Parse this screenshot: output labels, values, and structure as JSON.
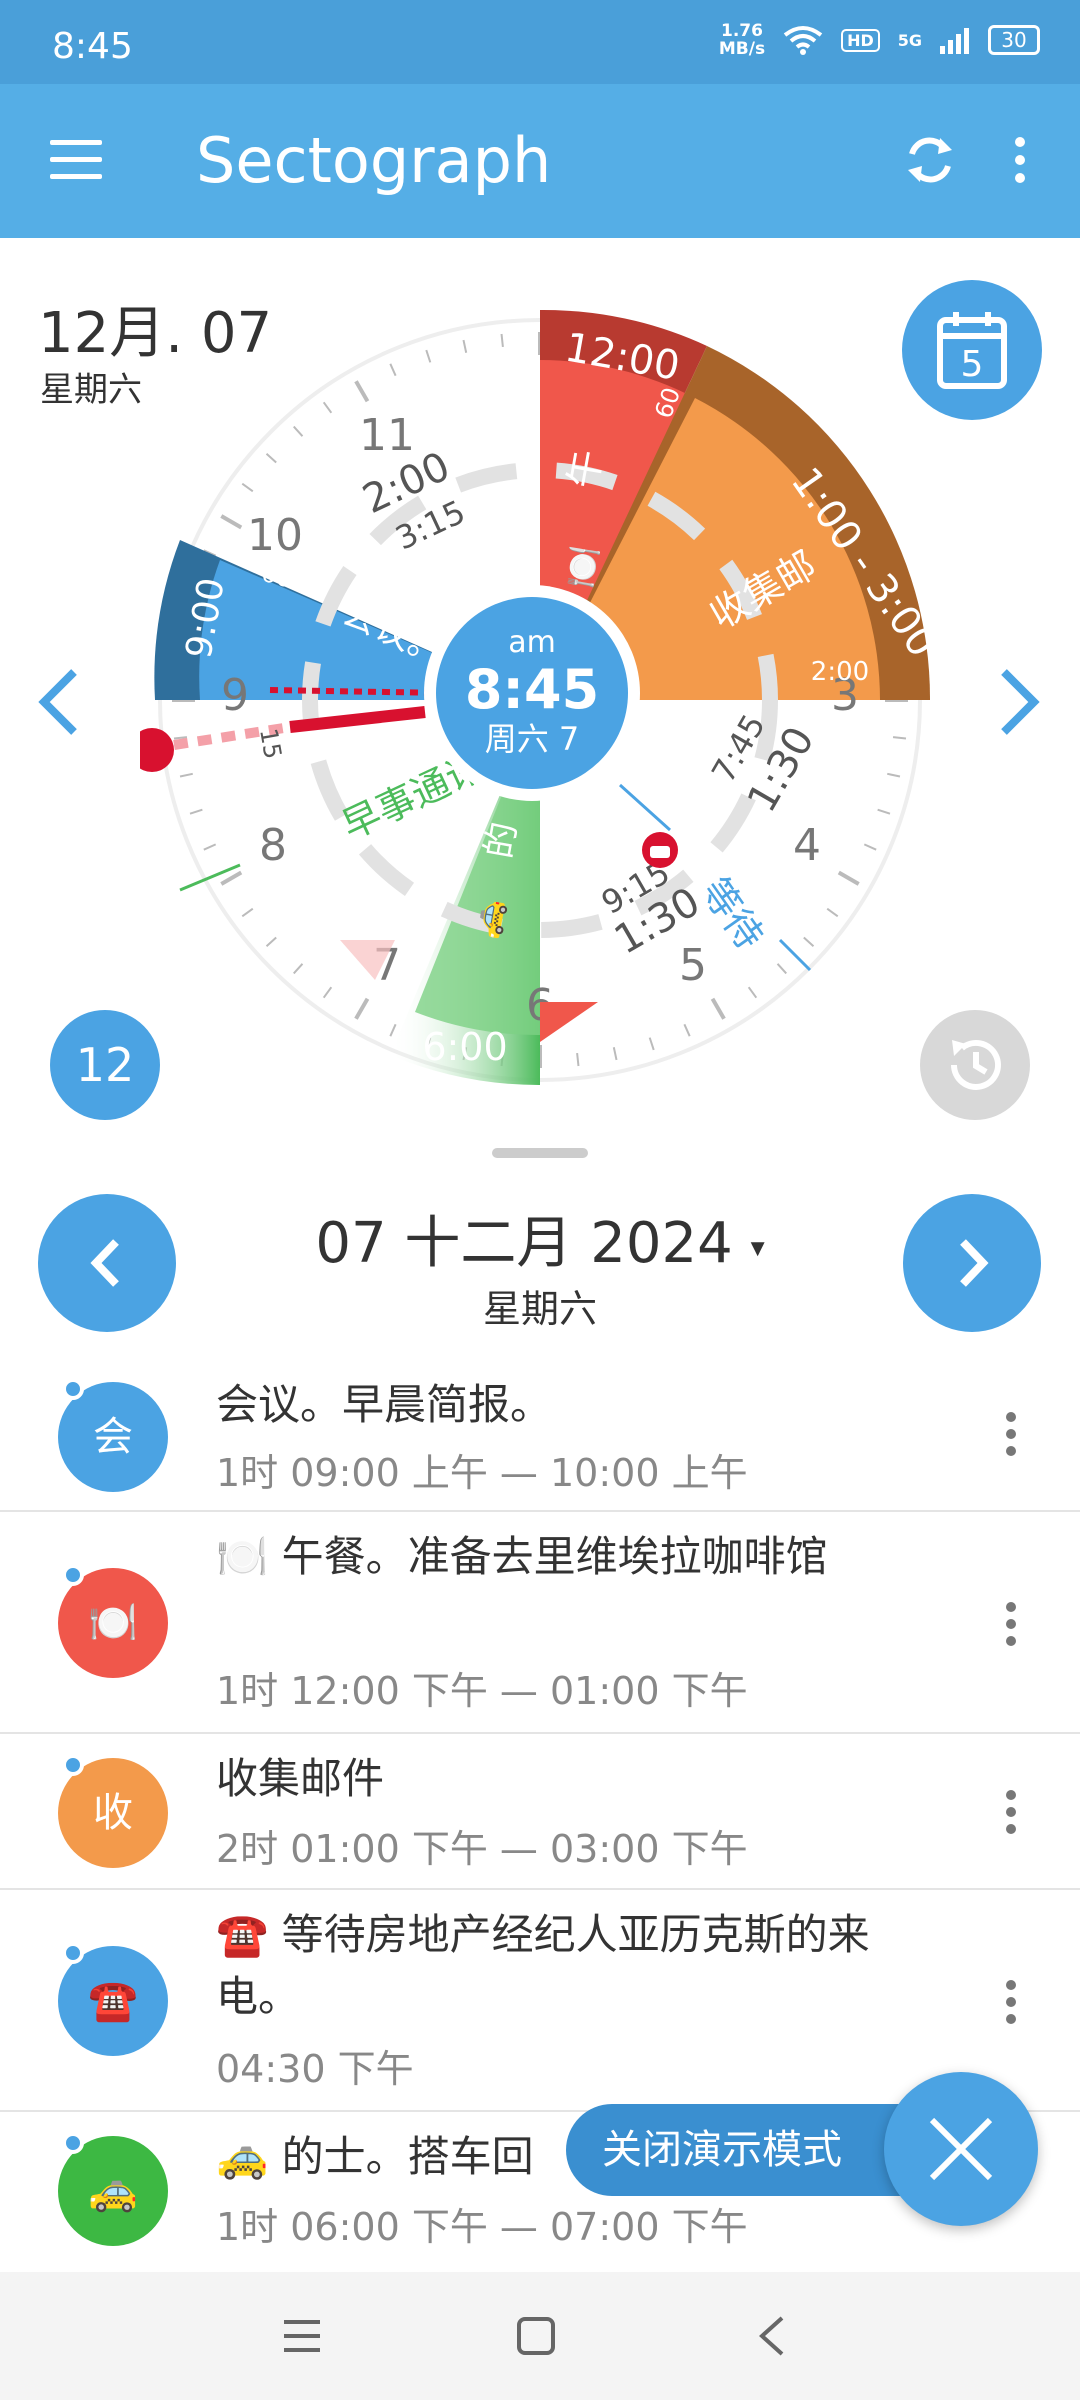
{
  "status_bar": {
    "time": "8:45",
    "net_speed_value": "1.76",
    "net_speed_unit": "MB/s",
    "hd": "HD",
    "signal": "5G",
    "battery": "30"
  },
  "app_bar": {
    "title": "Sectograph",
    "menu_icon": "hamburger-menu-icon",
    "sync_icon": "sync-icon",
    "more_icon": "more-vert-icon"
  },
  "clock": {
    "date_title": "12月. 07",
    "date_sub": "星期六",
    "calendar_day": "5",
    "center_ampm": "am",
    "center_time": "8:45",
    "center_day": "周六 7",
    "hour_labels": [
      "11",
      "10",
      "9",
      "8",
      "7",
      "6",
      "5",
      "4",
      "3"
    ],
    "sectors": [
      {
        "label": "午",
        "time_top": "12:00",
        "time_side": "60",
        "color": "#f0574b",
        "emoji": "🍽️"
      },
      {
        "label": "收集邮",
        "time_range": "1:00 - 3:00",
        "time_end": "2:00",
        "color": "#f39a4b"
      },
      {
        "label": "会议。早",
        "time_side": "9:00",
        "minutes": "60",
        "color": "#4ba3e3"
      },
      {
        "label": "的",
        "time_bottom": "6:00",
        "color": "#4cbb5b",
        "emoji": "🚕"
      }
    ],
    "annotations": {
      "past_a": "2:00",
      "past_b": "3:15",
      "upcoming_a": "7:45",
      "upcoming_b": "1:30",
      "upcoming_c": "9:15",
      "upcoming_d": "1:30",
      "note_green": "早事通讯",
      "note_blue": "等待",
      "small_15": "15"
    },
    "btn_12": "12"
  },
  "date_nav": {
    "date": "07 十二月 2024",
    "caret": "▾",
    "weekday": "星期六"
  },
  "events": [
    {
      "avatar": "会",
      "color": "#4ba3e3",
      "title": "会议。早晨简报。",
      "time": "1时  09:00 上午 — 10:00 上午"
    },
    {
      "avatar": "🍽️",
      "color": "#f0574b",
      "title": "🍽️ 午餐。准备去里维埃拉咖啡馆",
      "time": "1时  12:00 下午 — 01:00 下午"
    },
    {
      "avatar": "收",
      "color": "#f39a4b",
      "title": "收集邮件",
      "time": "2时  01:00 下午 — 03:00 下午"
    },
    {
      "avatar": "☎️",
      "color": "#4ba3e3",
      "title": "☎️ 等待房地产经纪人亚历克斯的来电。",
      "time": "04:30 下午"
    },
    {
      "avatar": "🚕",
      "color": "#3db843",
      "title": "🚕 的士。搭车回",
      "time": "1时  06:00 下午 — 07:00 下午"
    }
  ],
  "demo": {
    "label": "关闭演示模式"
  }
}
